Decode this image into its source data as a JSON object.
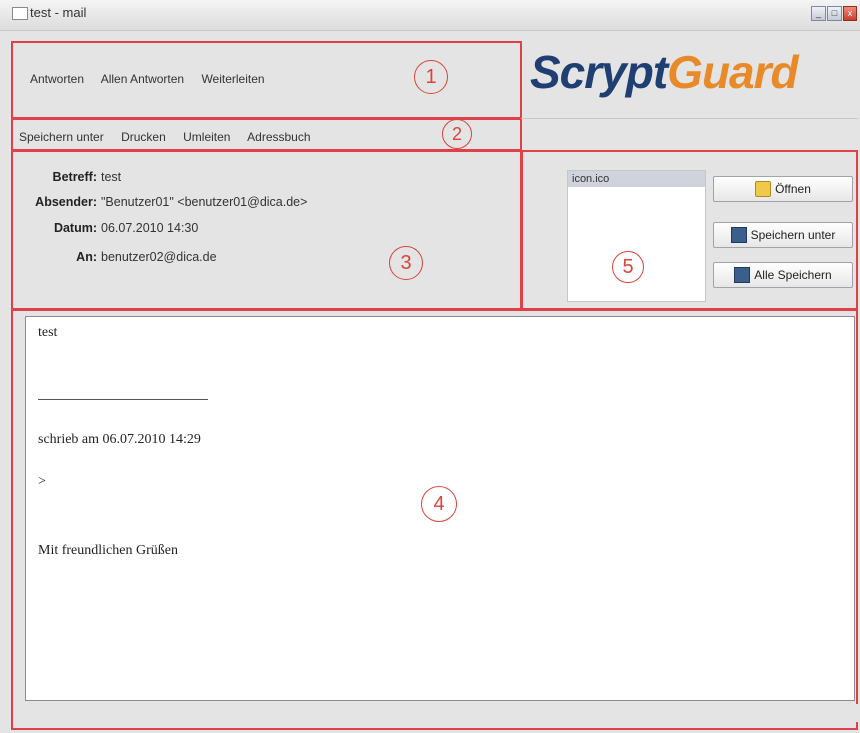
{
  "window": {
    "title": "test - mail",
    "controls": [
      "_",
      "□",
      "x"
    ]
  },
  "toolbar_primary": [
    "Antworten",
    "Allen Antworten",
    "Weiterleiten"
  ],
  "toolbar_secondary": [
    "Speichern unter",
    "Drucken",
    "Umleiten",
    "Adressbuch"
  ],
  "logo": {
    "part1": "Scrypt",
    "part2": "Guard",
    "colors": {
      "part1": "#1f3e72",
      "part2": "#e98a28"
    }
  },
  "header": {
    "subject_label": "Betreff:",
    "subject": "test",
    "from_label": "Absender:",
    "from": "\"Benutzer01\" <benutzer01@dica.de>",
    "date_label": "Datum:",
    "date": "06.07.2010 14:30",
    "to_label": "An:",
    "to": "benutzer02@dica.de"
  },
  "attachments": {
    "items": [
      "icon.ico"
    ]
  },
  "attachment_buttons": {
    "open": "Öffnen",
    "save_as": "Speichern unter",
    "save_all": "Alle Speichern"
  },
  "message_body": {
    "line1": "test",
    "line2": "schrieb am 06.07.2010 14:29",
    "line3": ">",
    "line4": "Mit freundlichen Grüßen"
  },
  "annotations": [
    "1",
    "2",
    "3",
    "4",
    "5"
  ],
  "annotation_color": "#e0404a"
}
